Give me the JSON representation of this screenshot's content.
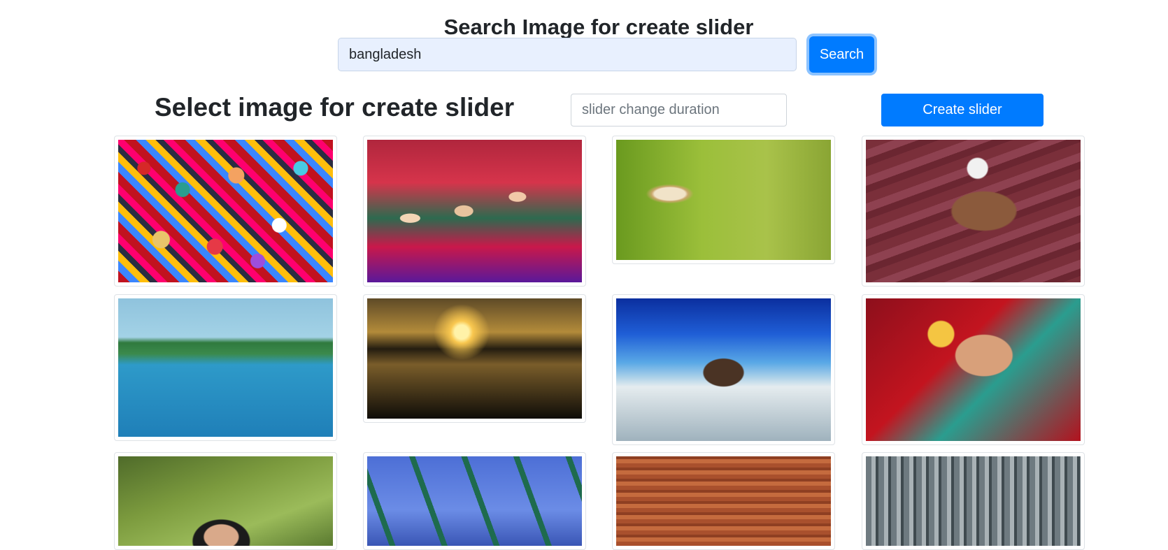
{
  "header": {
    "title": "Search Image for create slider"
  },
  "search": {
    "value": "bangladesh",
    "button_label": "Search"
  },
  "slider": {
    "section_title": "Select image for create slider",
    "duration_placeholder": "slider change duration",
    "create_button_label": "Create slider"
  },
  "gallery": {
    "images": [
      {
        "subject": "colorful masks"
      },
      {
        "subject": "crowd of women"
      },
      {
        "subject": "butterfly on plant"
      },
      {
        "subject": "old man with net"
      },
      {
        "subject": "boat on lake"
      },
      {
        "subject": "river sunset"
      },
      {
        "subject": "boat on beach"
      },
      {
        "subject": "bride"
      },
      {
        "subject": "girl in garden"
      },
      {
        "subject": "boats with flags"
      },
      {
        "subject": "brick field"
      },
      {
        "subject": "city skyline"
      }
    ]
  }
}
